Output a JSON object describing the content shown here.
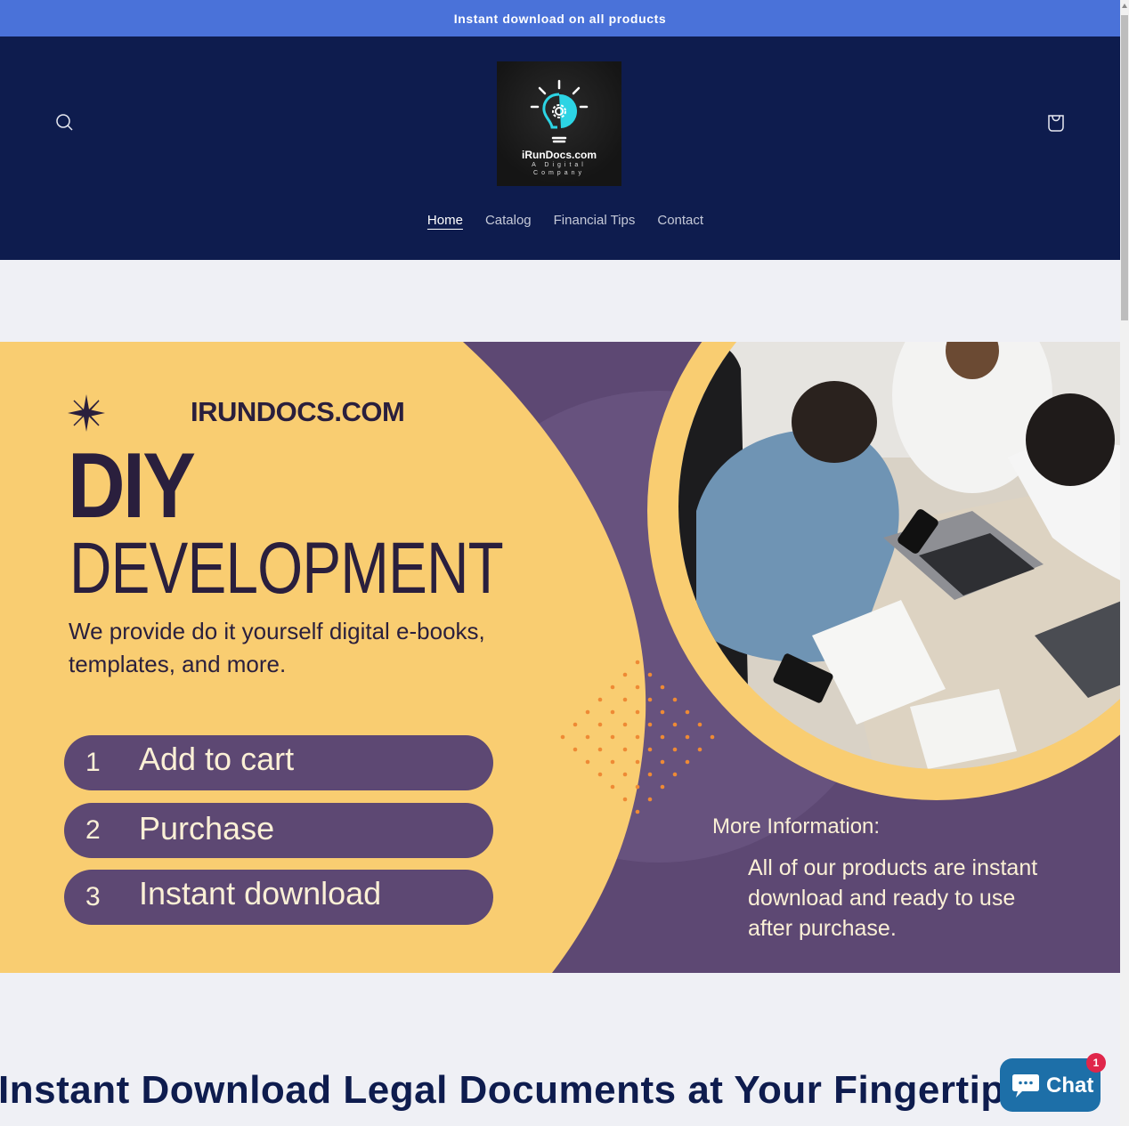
{
  "announcement": {
    "text": "Instant download on all products"
  },
  "header": {
    "logo": {
      "name": "iRunDocs.com",
      "tagline_line1": "A Digital",
      "tagline_line2": "Company"
    },
    "search_icon": "search-icon",
    "cart_icon": "shopping-bag-icon"
  },
  "nav": {
    "items": [
      {
        "label": "Home",
        "active": true
      },
      {
        "label": "Catalog",
        "active": false
      },
      {
        "label": "Financial Tips",
        "active": false
      },
      {
        "label": "Contact",
        "active": false
      }
    ]
  },
  "hero": {
    "brand": "IRUNDOCS.COM",
    "headline_bold": "DIY",
    "headline_light": "DEVELOPMENT",
    "description": "We provide do it yourself digital e-books, templates, and more.",
    "steps": [
      {
        "number": "1",
        "label": "Add to cart"
      },
      {
        "number": "2",
        "label": "Purchase"
      },
      {
        "number": "3",
        "label": "Instant download"
      }
    ],
    "more_info_title": "More Information:",
    "more_info_body": "All of our products are instant download and ready to use after purchase.",
    "colors": {
      "yellow": "#f9cd71",
      "purple": "#5d4873",
      "dots": "#ee8a35"
    }
  },
  "section": {
    "title": "Instant Download Legal Documents at Your Fingertips"
  },
  "chat": {
    "label": "Chat",
    "badge_count": "1"
  },
  "colors": {
    "announcement_bg": "#4a72d9",
    "header_bg": "#0e1c4e",
    "page_bg": "#eff0f5",
    "chat_bg": "#1d6fa8",
    "badge_bg": "#e0264a"
  }
}
